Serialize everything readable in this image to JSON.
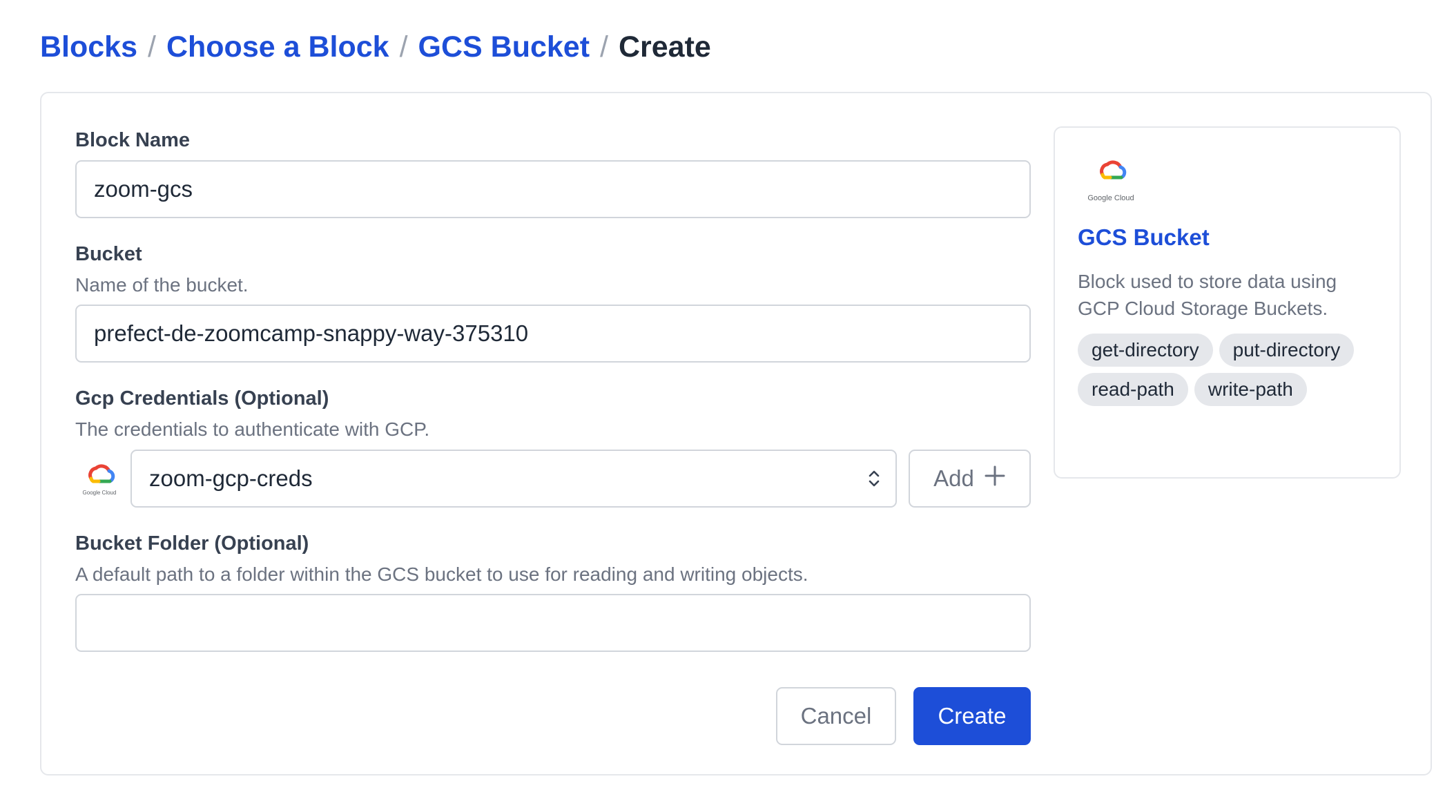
{
  "breadcrumb": {
    "items": [
      "Blocks",
      "Choose a Block",
      "GCS Bucket"
    ],
    "current": "Create",
    "separator": "/"
  },
  "form": {
    "block_name": {
      "label": "Block Name",
      "value": "zoom-gcs"
    },
    "bucket": {
      "label": "Bucket",
      "description": "Name of the bucket.",
      "value": "prefect-de-zoomcamp-snappy-way-375310"
    },
    "gcp_credentials": {
      "label": "Gcp Credentials (Optional)",
      "description": "The credentials to authenticate with GCP.",
      "value": "zoom-gcp-creds",
      "add_label": "Add",
      "logo_text": "Google Cloud"
    },
    "bucket_folder": {
      "label": "Bucket Folder (Optional)",
      "description": "A default path to a folder within the GCS bucket to use for reading and writing objects.",
      "value": ""
    },
    "cancel_label": "Cancel",
    "create_label": "Create"
  },
  "info": {
    "logo_text": "Google Cloud",
    "title": "GCS Bucket",
    "description": "Block used to store data using GCP Cloud Storage Buckets.",
    "tags": [
      "get-directory",
      "put-directory",
      "read-path",
      "write-path"
    ]
  },
  "colors": {
    "accent": "#1d4ed8",
    "gc_red": "#ea4335",
    "gc_yellow": "#fbbc04",
    "gc_green": "#34a853",
    "gc_blue": "#4285f4"
  }
}
